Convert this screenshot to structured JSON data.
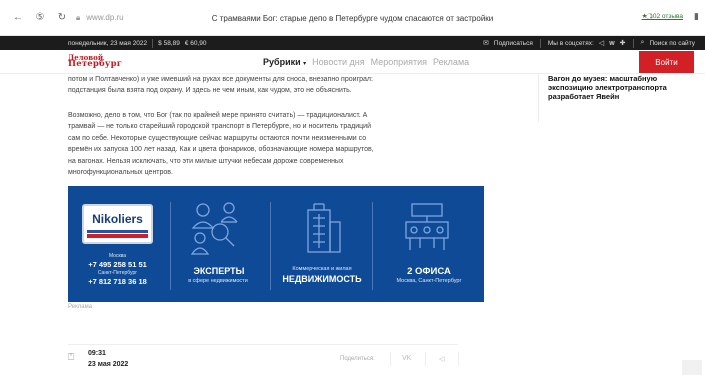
{
  "browser": {
    "url": "www.dp.ru",
    "tab_title": "С трамваями Бог: старые депо в Петербурге чудом спасаются от застройки",
    "reviews": "★ 102 отзыва",
    "icons": [
      "back-arrow-icon",
      "yandex-icon",
      "reload-icon",
      "lock-icon",
      "extension-icon",
      "bookmark-icon"
    ]
  },
  "topbar": {
    "date": "понедельник, 23 мая 2022",
    "usd": "$ 58,89",
    "eur": "€ 60,90",
    "subscribe": "Подписаться",
    "social": "Мы в соцсетях:",
    "search": "Поиск по сайту"
  },
  "header": {
    "logo_line1": "Деловой",
    "logo_line2": "Петербург",
    "menu": {
      "rubriki": "Рубрики",
      "news": "Новости дня",
      "events": "Мероприятия",
      "ads": "Реклама"
    },
    "login": "Войти"
  },
  "article": {
    "line1": "потом и Полтавченко) и уже имевший на руках все документы для сноса, внезапно проиграл:",
    "line2": "подстанция была взята под охрану. И здесь не чем иным, как чудом, это не объяснить.",
    "p2_1": "Возможно, дело в том, что Бог (так по крайней мере принято считать) — традиционалист. А",
    "p2_2": "трамвай — не только старейший городской транспорт в Петербурге, но и носитель традиций",
    "p2_3": "сам по себе. Некоторые существующие сейчас маршруты остаются почти неизменными со",
    "p2_4": "времён их запуска 100 лет назад. Как и цвета фонариков, обозначающие номера маршрутов,",
    "p2_5": "на вагонах. Нельзя исключать, что эти милые штучки небесам дороже современных",
    "p2_6": "многофункциональных центров."
  },
  "sidebar": {
    "news_1": "Вагон до музея: масштабную",
    "news_2": "экспозицию электротранспорта",
    "news_3": "разработает Явейн"
  },
  "banner": {
    "brand": "Nikoliers",
    "city1": "Москва",
    "phone1": "+7 495 258 51 51",
    "city2": "Санкт-Петербург",
    "phone2": "+7 812 718 36 18",
    "col2_title": "ЭКСПЕРТЫ",
    "col2_sub": "в сфере недвижимости",
    "col3_sub": "Коммерческая и жилая",
    "col3_title": "НЕДВИЖИМОСТЬ",
    "col4_title": "2 ОФИСА",
    "col4_sub": "Москва, Санкт-Петербург",
    "ad_label": "Реклама",
    "color_bg": "#0f4a96"
  },
  "meta": {
    "time": "09:31",
    "date": "23 мая 2022",
    "share": "Поделиться:",
    "vk": "VK",
    "tg": "◁"
  }
}
